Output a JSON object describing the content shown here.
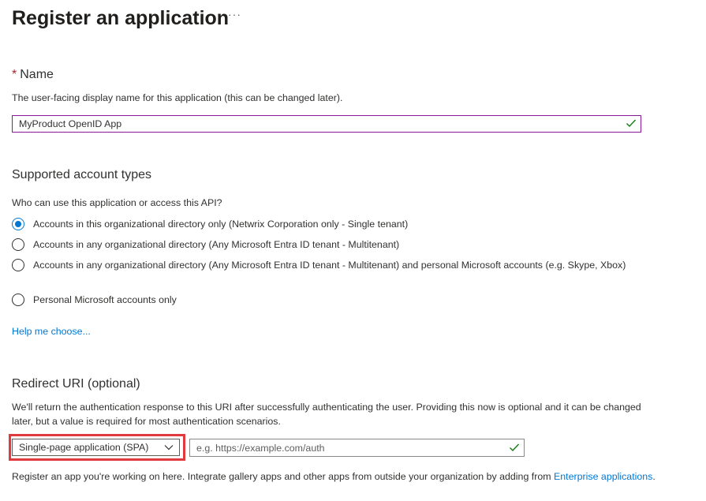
{
  "header": {
    "title": "Register an application",
    "more_label": "···"
  },
  "name_section": {
    "required_mark": "*",
    "title": "Name",
    "description": "The user-facing display name for this application (this can be changed later).",
    "value": "MyProduct OpenID App"
  },
  "account_types": {
    "title": "Supported account types",
    "question": "Who can use this application or access this API?",
    "options": [
      {
        "label": "Accounts in this organizational directory only (Netwrix Corporation only - Single tenant)",
        "selected": true
      },
      {
        "label": "Accounts in any organizational directory (Any Microsoft Entra ID tenant - Multitenant)",
        "selected": false
      },
      {
        "label": "Accounts in any organizational directory (Any Microsoft Entra ID tenant - Multitenant) and personal Microsoft accounts (e.g. Skype, Xbox)",
        "selected": false
      },
      {
        "label": "Personal Microsoft accounts only",
        "selected": false
      }
    ],
    "help_link": "Help me choose..."
  },
  "redirect": {
    "title": "Redirect URI (optional)",
    "description": "We'll return the authentication response to this URI after successfully authenticating the user. Providing this now is optional and it can be changed later, but a value is required for most authentication scenarios.",
    "platform_selected": "Single-page application (SPA)",
    "uri_value": "",
    "uri_placeholder": "e.g. https://example.com/auth"
  },
  "footer": {
    "text": "Register an app you're working on here. Integrate gallery apps and other apps from outside your organization by adding from ",
    "link": "Enterprise applications",
    "end": "."
  },
  "colors": {
    "accent": "#0078d4",
    "success": "#107c10",
    "highlight": "#e0393e",
    "focus_border": "#881798"
  }
}
